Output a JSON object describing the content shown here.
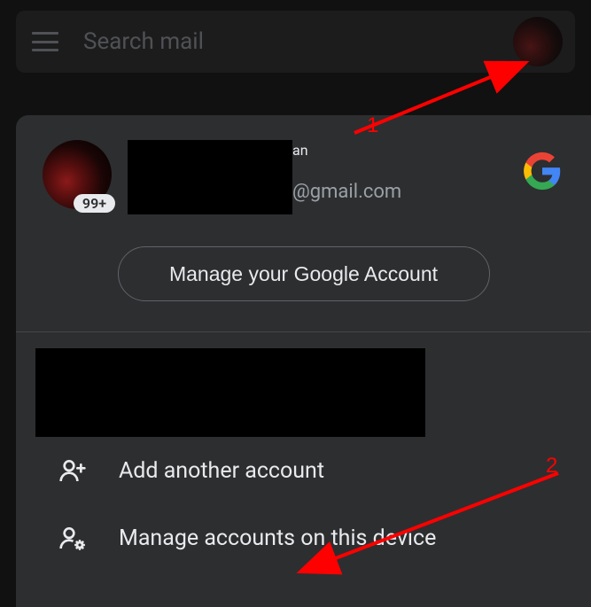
{
  "search": {
    "placeholder": "Search mail"
  },
  "account": {
    "name_suffix": "an",
    "email_suffix": "@gmail.com",
    "badge": "99+",
    "manage_button": "Manage your Google Account"
  },
  "menu": {
    "add_account": "Add another account",
    "manage_device": "Manage accounts on this device"
  },
  "annotations": {
    "one": "1",
    "two": "2"
  }
}
